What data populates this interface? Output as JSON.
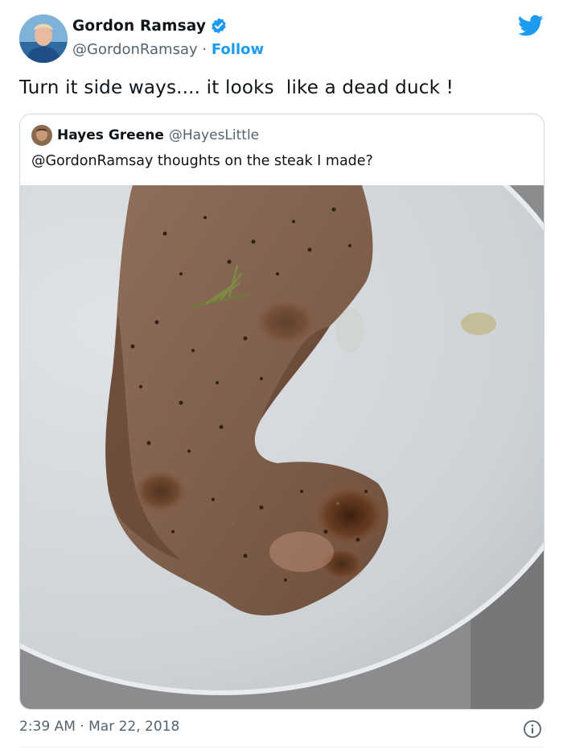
{
  "author": {
    "display_name": "Gordon Ramsay",
    "handle": "@GordonRamsay",
    "separator": "·",
    "follow_label": "Follow",
    "avatar_icon": "user-avatar",
    "verified_icon": "verified-badge-icon"
  },
  "brand": {
    "icon": "twitter-bird-icon",
    "color": "#1d9bf0"
  },
  "tweet": {
    "text": "Turn it side ways.... it looks  like a dead duck !"
  },
  "quoted_tweet": {
    "display_name": "Hayes Greene",
    "handle": "@HayesLittle",
    "text": "@GordonRamsay thoughts on the steak I made?",
    "media": "photo"
  },
  "meta": {
    "time": "2:39 AM",
    "separator": "·",
    "date": "Mar 22, 2018",
    "info_icon": "info-icon"
  },
  "colors": {
    "accent": "#1d9bf0",
    "text_primary": "#0f1419",
    "text_secondary": "#536471",
    "border": "#cfd9de"
  }
}
